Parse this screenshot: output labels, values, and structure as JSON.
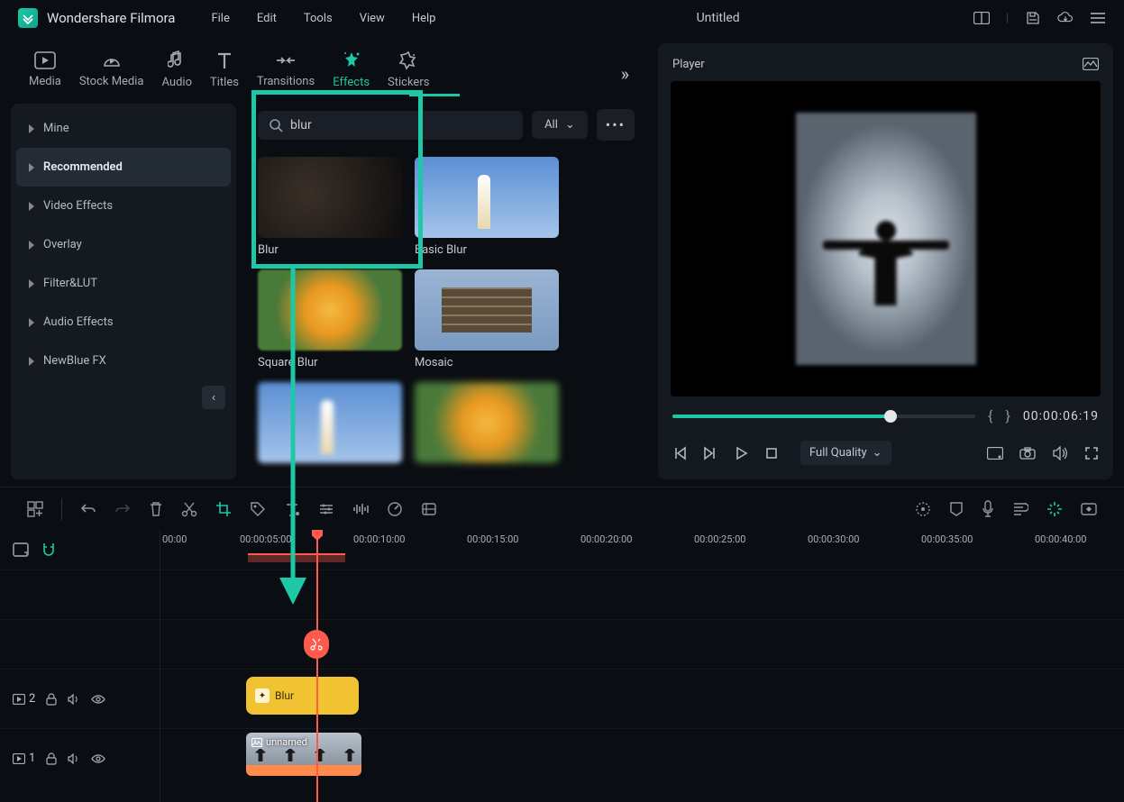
{
  "app": {
    "name": "Wondershare Filmora",
    "document": "Untitled"
  },
  "menu": [
    "File",
    "Edit",
    "Tools",
    "View",
    "Help"
  ],
  "tabs": [
    {
      "label": "Media"
    },
    {
      "label": "Stock Media"
    },
    {
      "label": "Audio"
    },
    {
      "label": "Titles"
    },
    {
      "label": "Transitions"
    },
    {
      "label": "Effects",
      "active": true
    },
    {
      "label": "Stickers"
    }
  ],
  "sidebar": {
    "items": [
      {
        "label": "Mine"
      },
      {
        "label": "Recommended",
        "active": true
      },
      {
        "label": "Video Effects"
      },
      {
        "label": "Overlay"
      },
      {
        "label": "Filter&LUT"
      },
      {
        "label": "Audio Effects"
      },
      {
        "label": "NewBlue FX"
      }
    ]
  },
  "search": {
    "value": "blur",
    "filter": "All"
  },
  "effects": [
    {
      "label": "Blur"
    },
    {
      "label": "Basic Blur"
    },
    {
      "label": "Square Blur"
    },
    {
      "label": "Mosaic"
    }
  ],
  "player": {
    "title": "Player",
    "timecode": "00:00:06:19",
    "quality": "Full Quality"
  },
  "ruler": [
    "00:00",
    "00:00:05:00",
    "00:00:10:00",
    "00:00:15:00",
    "00:00:20:00",
    "00:00:25:00",
    "00:00:30:00",
    "00:00:35:00",
    "00:00:40:00"
  ],
  "tracks": {
    "effect_track": {
      "index": "2",
      "clip_label": "Blur"
    },
    "video_track": {
      "index": "1",
      "clip_label": "unnamed"
    }
  }
}
